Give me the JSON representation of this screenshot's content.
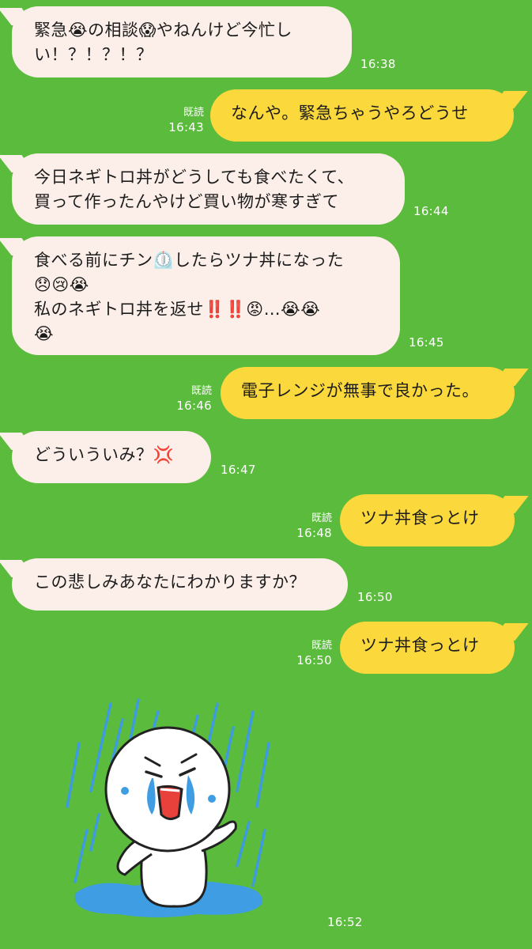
{
  "messages": [
    {
      "side": "left",
      "text": "緊急😭の相談😱やねんけど今忙し\nい！？！？！？",
      "time": "16:38"
    },
    {
      "side": "right",
      "text": "なんや。緊急ちゃうやろどうせ",
      "read": "既読",
      "time": "16:43"
    },
    {
      "side": "left",
      "text": "今日ネギトロ丼がどうしても食べたくて、\n買って作ったんやけど買い物が寒すぎて",
      "time": "16:44"
    },
    {
      "side": "left",
      "text": "食べる前にチン⏲️したらツナ丼になった\n😞😢😭\n私のネギトロ丼を返せ‼️‼️😡…😭😭\n😭",
      "time": "16:45"
    },
    {
      "side": "right",
      "text": "電子レンジが無事で良かった。",
      "read": "既読",
      "time": "16:46"
    },
    {
      "side": "left",
      "text": "どういういみ？💢",
      "time": "16:47"
    },
    {
      "side": "right",
      "text": "ツナ丼食っとけ",
      "read": "既読",
      "time": "16:48"
    },
    {
      "side": "left",
      "text": "この悲しみあなたにわかりますか？",
      "time": "16:50"
    },
    {
      "side": "right",
      "text": "ツナ丼食っとけ",
      "read": "既読",
      "time": "16:50"
    }
  ],
  "sticker": {
    "icon": "crying-in-rain-sticker",
    "time": "16:52"
  },
  "colors": {
    "background": "#5bbb3c",
    "left_bubble": "#fcefe9",
    "right_bubble": "#fbd83b"
  }
}
